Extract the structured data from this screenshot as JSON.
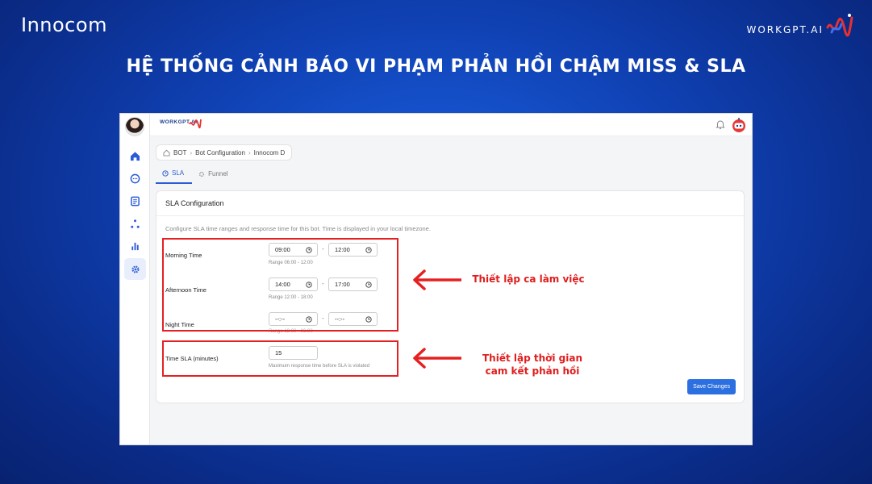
{
  "brand": {
    "left": "Innocom",
    "right": "WORKGPT.AI"
  },
  "headline": "HỆ THỐNG CẢNH BÁO VI PHẠM PHẢN HỒI CHẬM MISS & SLA",
  "app": {
    "logo_text": "WORKGPT.AI",
    "breadcrumb": [
      "BOT",
      "Bot Configuration",
      "Innocom D"
    ],
    "tabs": [
      {
        "label": "SLA",
        "active": true
      },
      {
        "label": "Funnel",
        "active": false
      }
    ],
    "card": {
      "title": "SLA Configuration",
      "description": "Configure SLA time ranges and response time for this bot. Time is displayed in your local timezone.",
      "rows": [
        {
          "label": "Morning Time",
          "start": "09:00",
          "end": "12:00",
          "hint": "Range 06:00 - 12:00"
        },
        {
          "label": "Afternoon Time",
          "start": "14:00",
          "end": "17:00",
          "hint": "Range 12:00 - 18:00"
        },
        {
          "label": "Night Time",
          "start": "--:--",
          "end": "--:--",
          "hint": "Range 18:00 - 06:00"
        }
      ],
      "sla": {
        "label": "Time SLA (minutes)",
        "value": "15",
        "hint": "Maximum response time before SLA is violated"
      },
      "dash": "-",
      "save_label": "Save Changes"
    }
  },
  "notes": {
    "shift": "Thiết lập ca làm việc",
    "sla_line1": "Thiết lập thời gian",
    "sla_line2": "cam kết phản hồi"
  },
  "colors": {
    "accent": "#2b6fe0",
    "annotation_red": "#e52020",
    "background": "#0f3fb0"
  }
}
